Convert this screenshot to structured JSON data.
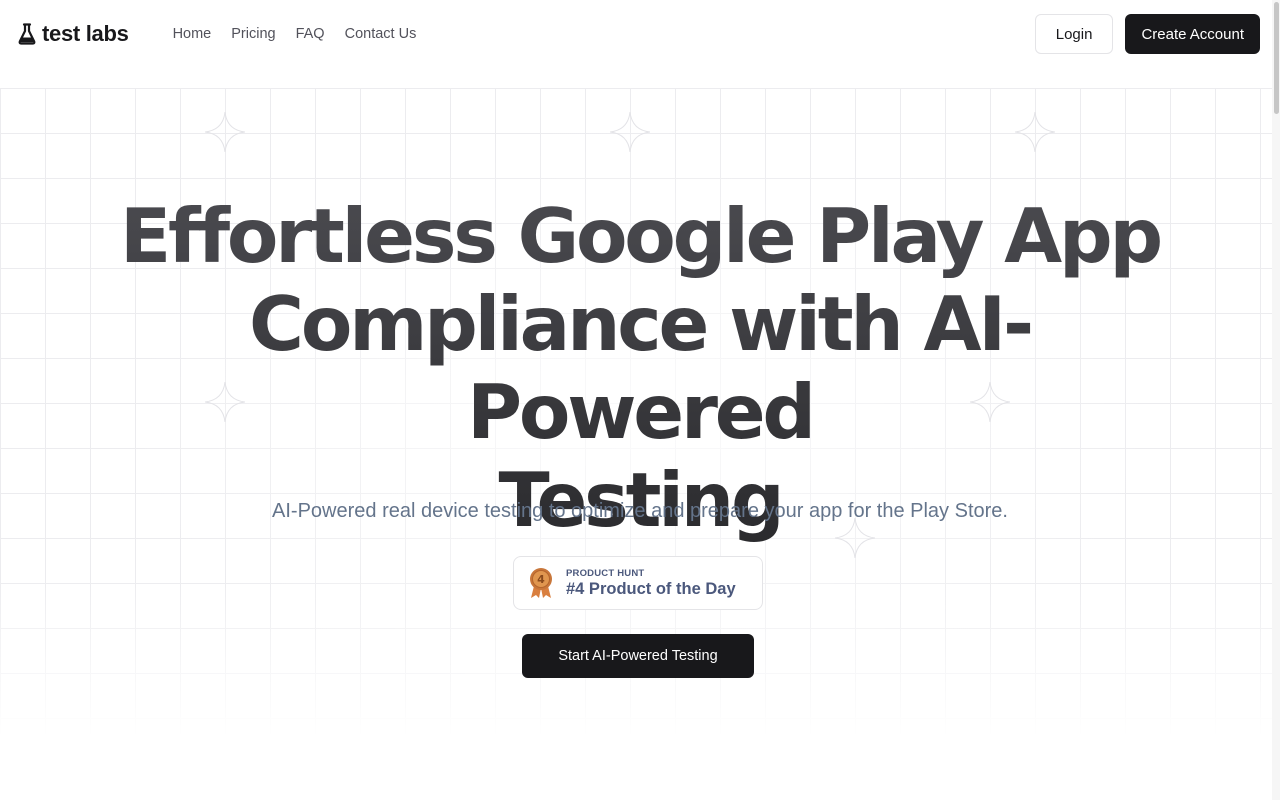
{
  "brand": {
    "name": "test labs",
    "icon": "flask-icon"
  },
  "nav": {
    "items": [
      {
        "label": "Home"
      },
      {
        "label": "Pricing"
      },
      {
        "label": "FAQ"
      },
      {
        "label": "Contact Us"
      }
    ]
  },
  "header": {
    "login_label": "Login",
    "create_account_label": "Create Account"
  },
  "hero": {
    "title_line1": "Effortless Google Play App",
    "title_line2": "Compliance with AI-Powered",
    "title_line3": "Testing",
    "subtitle": "AI-Powered real device testing to optimize and prepare your app for the Play Store.",
    "cta_label": "Start AI-Powered Testing"
  },
  "product_hunt": {
    "kicker": "PRODUCT HUNT",
    "title": "#4 Product of the Day",
    "medal_number": "4",
    "color": "#4b587c",
    "medal_color": "#c8763a"
  },
  "colors": {
    "primary": "#18181b",
    "muted_text": "#64748b",
    "nav_text": "#52525b"
  }
}
